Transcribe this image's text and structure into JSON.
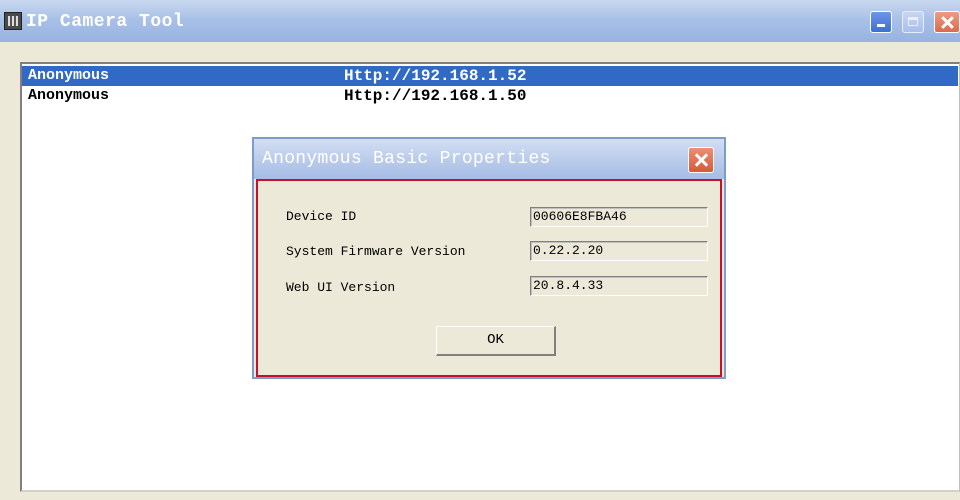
{
  "window": {
    "title": "IP Camera Tool",
    "accent_color": "#316ac5"
  },
  "devices": [
    {
      "name": "Anonymous",
      "url": "Http://192.168.1.52",
      "selected": true
    },
    {
      "name": "Anonymous",
      "url": "Http://192.168.1.50",
      "selected": false
    }
  ],
  "dialog": {
    "title": "Anonymous Basic Properties",
    "fields": [
      {
        "label": "Device ID",
        "value": "00606E8FBA46"
      },
      {
        "label": "System Firmware Version",
        "value": "0.22.2.20"
      },
      {
        "label": "Web UI Version",
        "value": "20.8.4.33"
      }
    ],
    "ok_label": "OK",
    "highlight_color": "#c8102e"
  }
}
